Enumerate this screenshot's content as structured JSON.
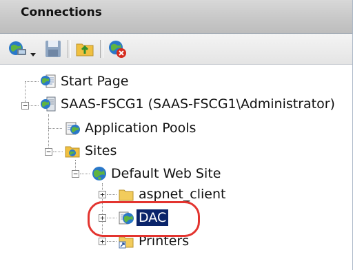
{
  "header": {
    "title": "Connections"
  },
  "toolbar": {
    "icons": [
      "connect-globe-icon",
      "dropdown-arrow-icon",
      "save-icon",
      "up-folder-icon",
      "disconnect-icon"
    ]
  },
  "tree": {
    "start_page": "Start Page",
    "server": "SAAS-FSCG1 (SAAS-FSCG1\\Administrator)",
    "app_pools": "Application Pools",
    "sites": "Sites",
    "default_site": "Default Web Site",
    "aspnet_client": "aspnet_client",
    "dac": "DAC",
    "printers": "Printers"
  },
  "colors": {
    "selection": "#0a246a",
    "annotation_ring": "#e3342f"
  }
}
